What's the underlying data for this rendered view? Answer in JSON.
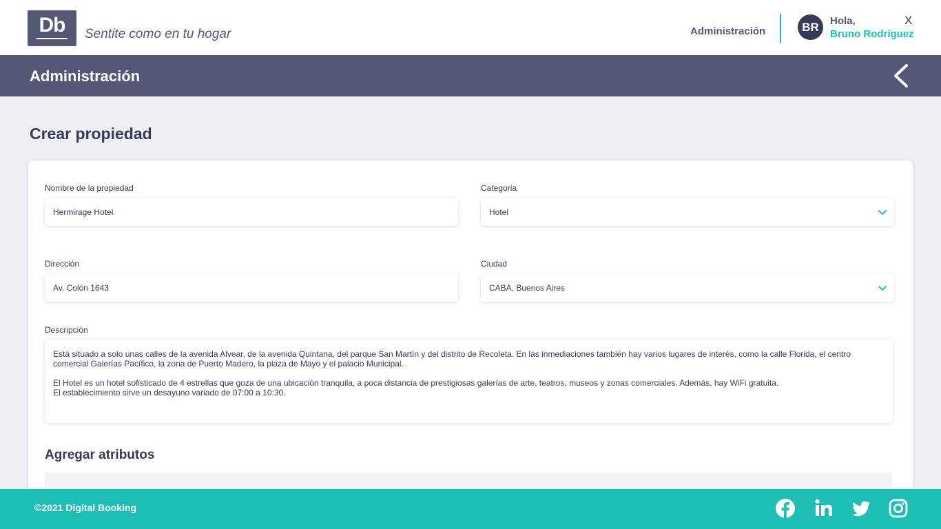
{
  "header": {
    "logo_text": "Db",
    "slogan": "Sentite como en tu hogar",
    "nav_admin": "Administración",
    "avatar_initials": "BR",
    "greeting": "Hola,",
    "user_name": "Bruno Rodríguez",
    "close_label": "X"
  },
  "section": {
    "title": "Administración",
    "back_icon": "chevron-left-icon"
  },
  "form": {
    "page_title": "Crear propiedad",
    "name_label": "Nombre de la propiedad",
    "name_value": "Hermirage Hotel",
    "category_label": "Categoria",
    "category_value": "Hotel",
    "address_label": "Dirección",
    "address_value": "Av. Colón 1643",
    "city_label": "Ciudad",
    "city_value": "CABA, Buenos Aires",
    "description_label": "Descripción",
    "description_p1": "Está situado a solo unas calles de la avenida Alvear, de la avenida Quintana, del parque San Martín y del distrito de Recoleta. En las inmediaciones también hay varios lugares de interés, como la calle Florida, el centro comercial Galerías Pacífico, la zona de Puerto Madero, la plaza de Mayo y el palacio Municipal.",
    "description_p2": "El Hotel es un hotel sofisticado de 4 estrellas que goza de una ubicación tranquila, a poca distancia de prestigiosas galerías de arte, teatros, museos y zonas comerciales. Además, hay WiFi gratuita.",
    "description_p3": "El establecimiento sirve un desayuno variado de 07:00 a 10:30.",
    "attributes_title": "Agregar atributos"
  },
  "footer": {
    "copyright": "©2021 Digital Booking",
    "social_icons": [
      "facebook-icon",
      "linkedin-icon",
      "twitter-icon",
      "instagram-icon"
    ]
  },
  "colors": {
    "primary": "#545776",
    "dark": "#383B58",
    "accent": "#1DBEB4",
    "background": "#EEEFF3"
  }
}
